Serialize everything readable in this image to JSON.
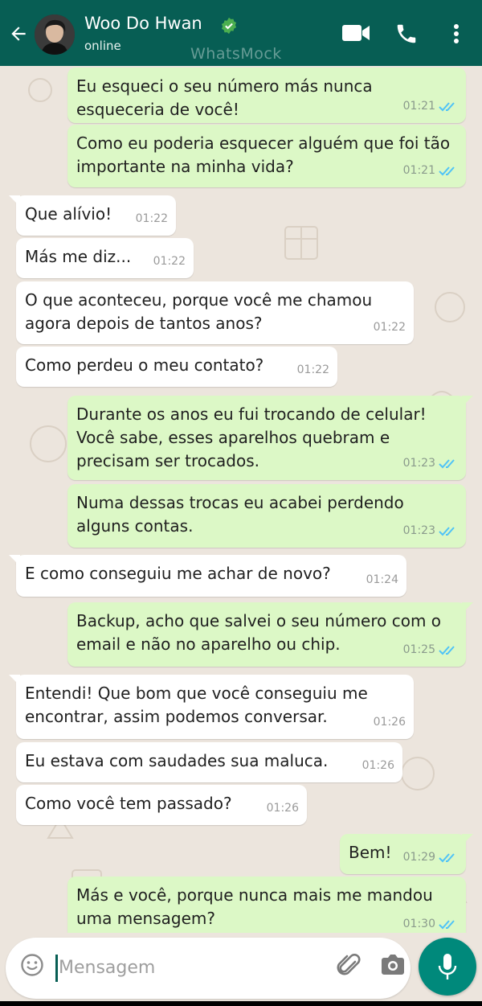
{
  "header": {
    "contact_name": "Woo Do Hwan",
    "status": "online",
    "watermark": "WhatsMock"
  },
  "colors": {
    "header": "#075e54",
    "outgoing_bubble": "#dcf8c6",
    "incoming_bubble": "#ffffff",
    "read_ticks": "#4fc3f7",
    "mic_button": "#00897b"
  },
  "icons": [
    "back-arrow-icon",
    "verified-badge-icon",
    "video-call-icon",
    "phone-icon",
    "more-vert-icon",
    "emoji-icon",
    "attach-icon",
    "camera-icon",
    "mic-icon",
    "read-ticks-icon"
  ],
  "messages": [
    {
      "dir": "out",
      "text": "Eu esqueci o seu número más nunca esqueceria de você!",
      "time": "01:21"
    },
    {
      "dir": "out",
      "text": "Como eu poderia esquecer alguém que foi tão importante na minha vida?",
      "time": "01:21"
    },
    {
      "dir": "in",
      "text": "Que alívio!",
      "time": "01:22"
    },
    {
      "dir": "in",
      "text": "Más me diz...",
      "time": "01:22"
    },
    {
      "dir": "in",
      "text": "O que aconteceu, porque você me chamou agora depois de tantos anos?",
      "time": "01:22"
    },
    {
      "dir": "in",
      "text": "Como perdeu o meu contato?",
      "time": "01:22"
    },
    {
      "dir": "out",
      "text": "Durante os anos eu fui trocando de celular! Você sabe, esses aparelhos quebram e precisam ser trocados.",
      "time": "01:23"
    },
    {
      "dir": "out",
      "text": "Numa dessas trocas eu acabei perdendo alguns contas.",
      "time": "01:23"
    },
    {
      "dir": "in",
      "text": "E como conseguiu me achar de novo?",
      "time": "01:24"
    },
    {
      "dir": "out",
      "text": "Backup, acho que salvei o seu número com o email e não no aparelho ou chip.",
      "time": "01:25"
    },
    {
      "dir": "in",
      "text": "Entendi! Que bom que você conseguiu me encontrar, assim podemos conversar.",
      "time": "01:26"
    },
    {
      "dir": "in",
      "text": "Eu estava com saudades sua maluca.",
      "time": "01:26"
    },
    {
      "dir": "in",
      "text": "Como você tem passado?",
      "time": "01:26"
    },
    {
      "dir": "out",
      "text": "Bem!",
      "time": "01:29"
    },
    {
      "dir": "out",
      "text": "Más e você, porque nunca mais me mandou uma mensagem?",
      "time": "01:30"
    }
  ],
  "composer": {
    "placeholder": "Mensagem"
  }
}
